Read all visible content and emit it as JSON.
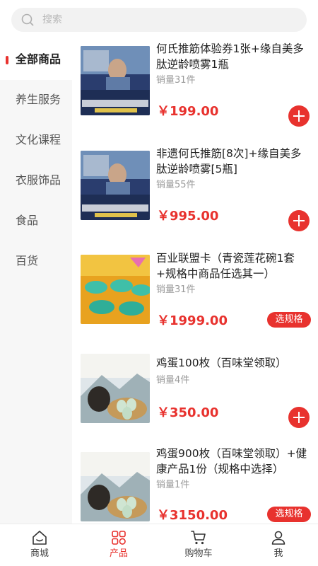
{
  "search": {
    "placeholder": "搜索"
  },
  "sidebar": {
    "items": [
      {
        "label": "全部商品"
      },
      {
        "label": "养生服务"
      },
      {
        "label": "文化课程"
      },
      {
        "label": "衣服饰品"
      },
      {
        "label": "食品"
      },
      {
        "label": "百货"
      }
    ]
  },
  "products": [
    {
      "name": "何氏推筋体验券1张+缘自美多肽逆龄喷雾1瓶",
      "sales": "销量31件",
      "price": "￥199.00",
      "action": "add"
    },
    {
      "name": "非遗何氏推筋[8次]+缘自美多肽逆龄喷雾[5瓶]",
      "sales": "销量55件",
      "price": "￥995.00",
      "action": "add"
    },
    {
      "name": "百业联盟卡（青瓷莲花碗1套+规格中商品任选其一）",
      "sales": "销量31件",
      "price": "￥1999.00",
      "action": "spec",
      "action_label": "选规格"
    },
    {
      "name": "鸡蛋100枚（百味堂领取）",
      "sales": "销量4件",
      "price": "￥350.00",
      "action": "add"
    },
    {
      "name": "鸡蛋900枚（百味堂领取）+健康产品1份（规格中选择）",
      "sales": "销量1件",
      "price": "￥3150.00",
      "action": "spec",
      "action_label": "选规格"
    }
  ],
  "bottom_nav": {
    "items": [
      {
        "label": "商城",
        "icon": "home-icon"
      },
      {
        "label": "产品",
        "icon": "grid-icon"
      },
      {
        "label": "购物车",
        "icon": "cart-icon"
      },
      {
        "label": "我",
        "icon": "user-icon"
      }
    ]
  },
  "colors": {
    "accent": "#e8322e",
    "sidebar_bg": "#f7f7f7",
    "muted": "#9a9a9a"
  }
}
